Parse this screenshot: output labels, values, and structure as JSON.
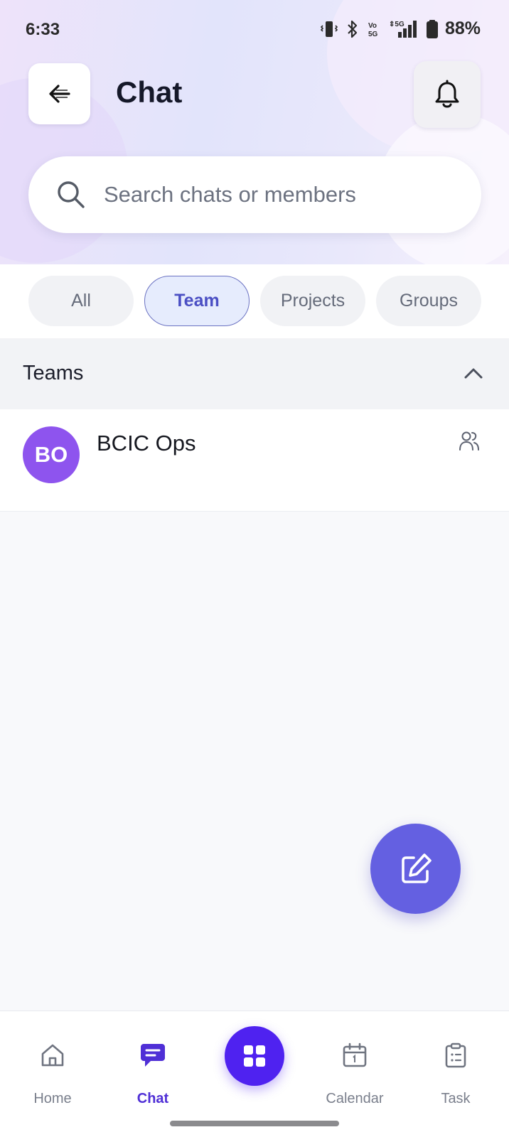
{
  "status_bar": {
    "time": "6:33",
    "battery": "88%",
    "icons": [
      "vibrate-icon",
      "bluetooth-icon",
      "volte-icon",
      "signal-5g-icon",
      "battery-icon"
    ]
  },
  "header": {
    "title": "Chat",
    "back_icon": "arrow-left-icon",
    "notification_icon": "bell-icon"
  },
  "search": {
    "placeholder": "Search chats or members",
    "value": ""
  },
  "filters": {
    "items": [
      "All",
      "Team",
      "Projects",
      "Groups"
    ],
    "selected": "Team"
  },
  "section": {
    "title": "Teams",
    "toggle_icon": "chevron-up-icon"
  },
  "chats": [
    {
      "initials": "BO",
      "name": "BCIC Ops",
      "icon": "members-icon",
      "avatar_color": "#8e54ee"
    }
  ],
  "fab": {
    "icon": "edit-icon"
  },
  "bottom_nav": {
    "items": [
      {
        "label": "Home",
        "icon": "home-icon"
      },
      {
        "label": "Chat",
        "icon": "chat-icon"
      },
      {
        "label": "",
        "icon": "grid-icon"
      },
      {
        "label": "Calendar",
        "icon": "calendar-icon"
      },
      {
        "label": "Task",
        "icon": "clipboard-icon"
      }
    ],
    "active": "Chat"
  },
  "colors": {
    "accent": "#4f22f0",
    "fab": "#6460e1",
    "active_chip_text": "#4b4fc4",
    "avatar": "#8e54ee"
  }
}
